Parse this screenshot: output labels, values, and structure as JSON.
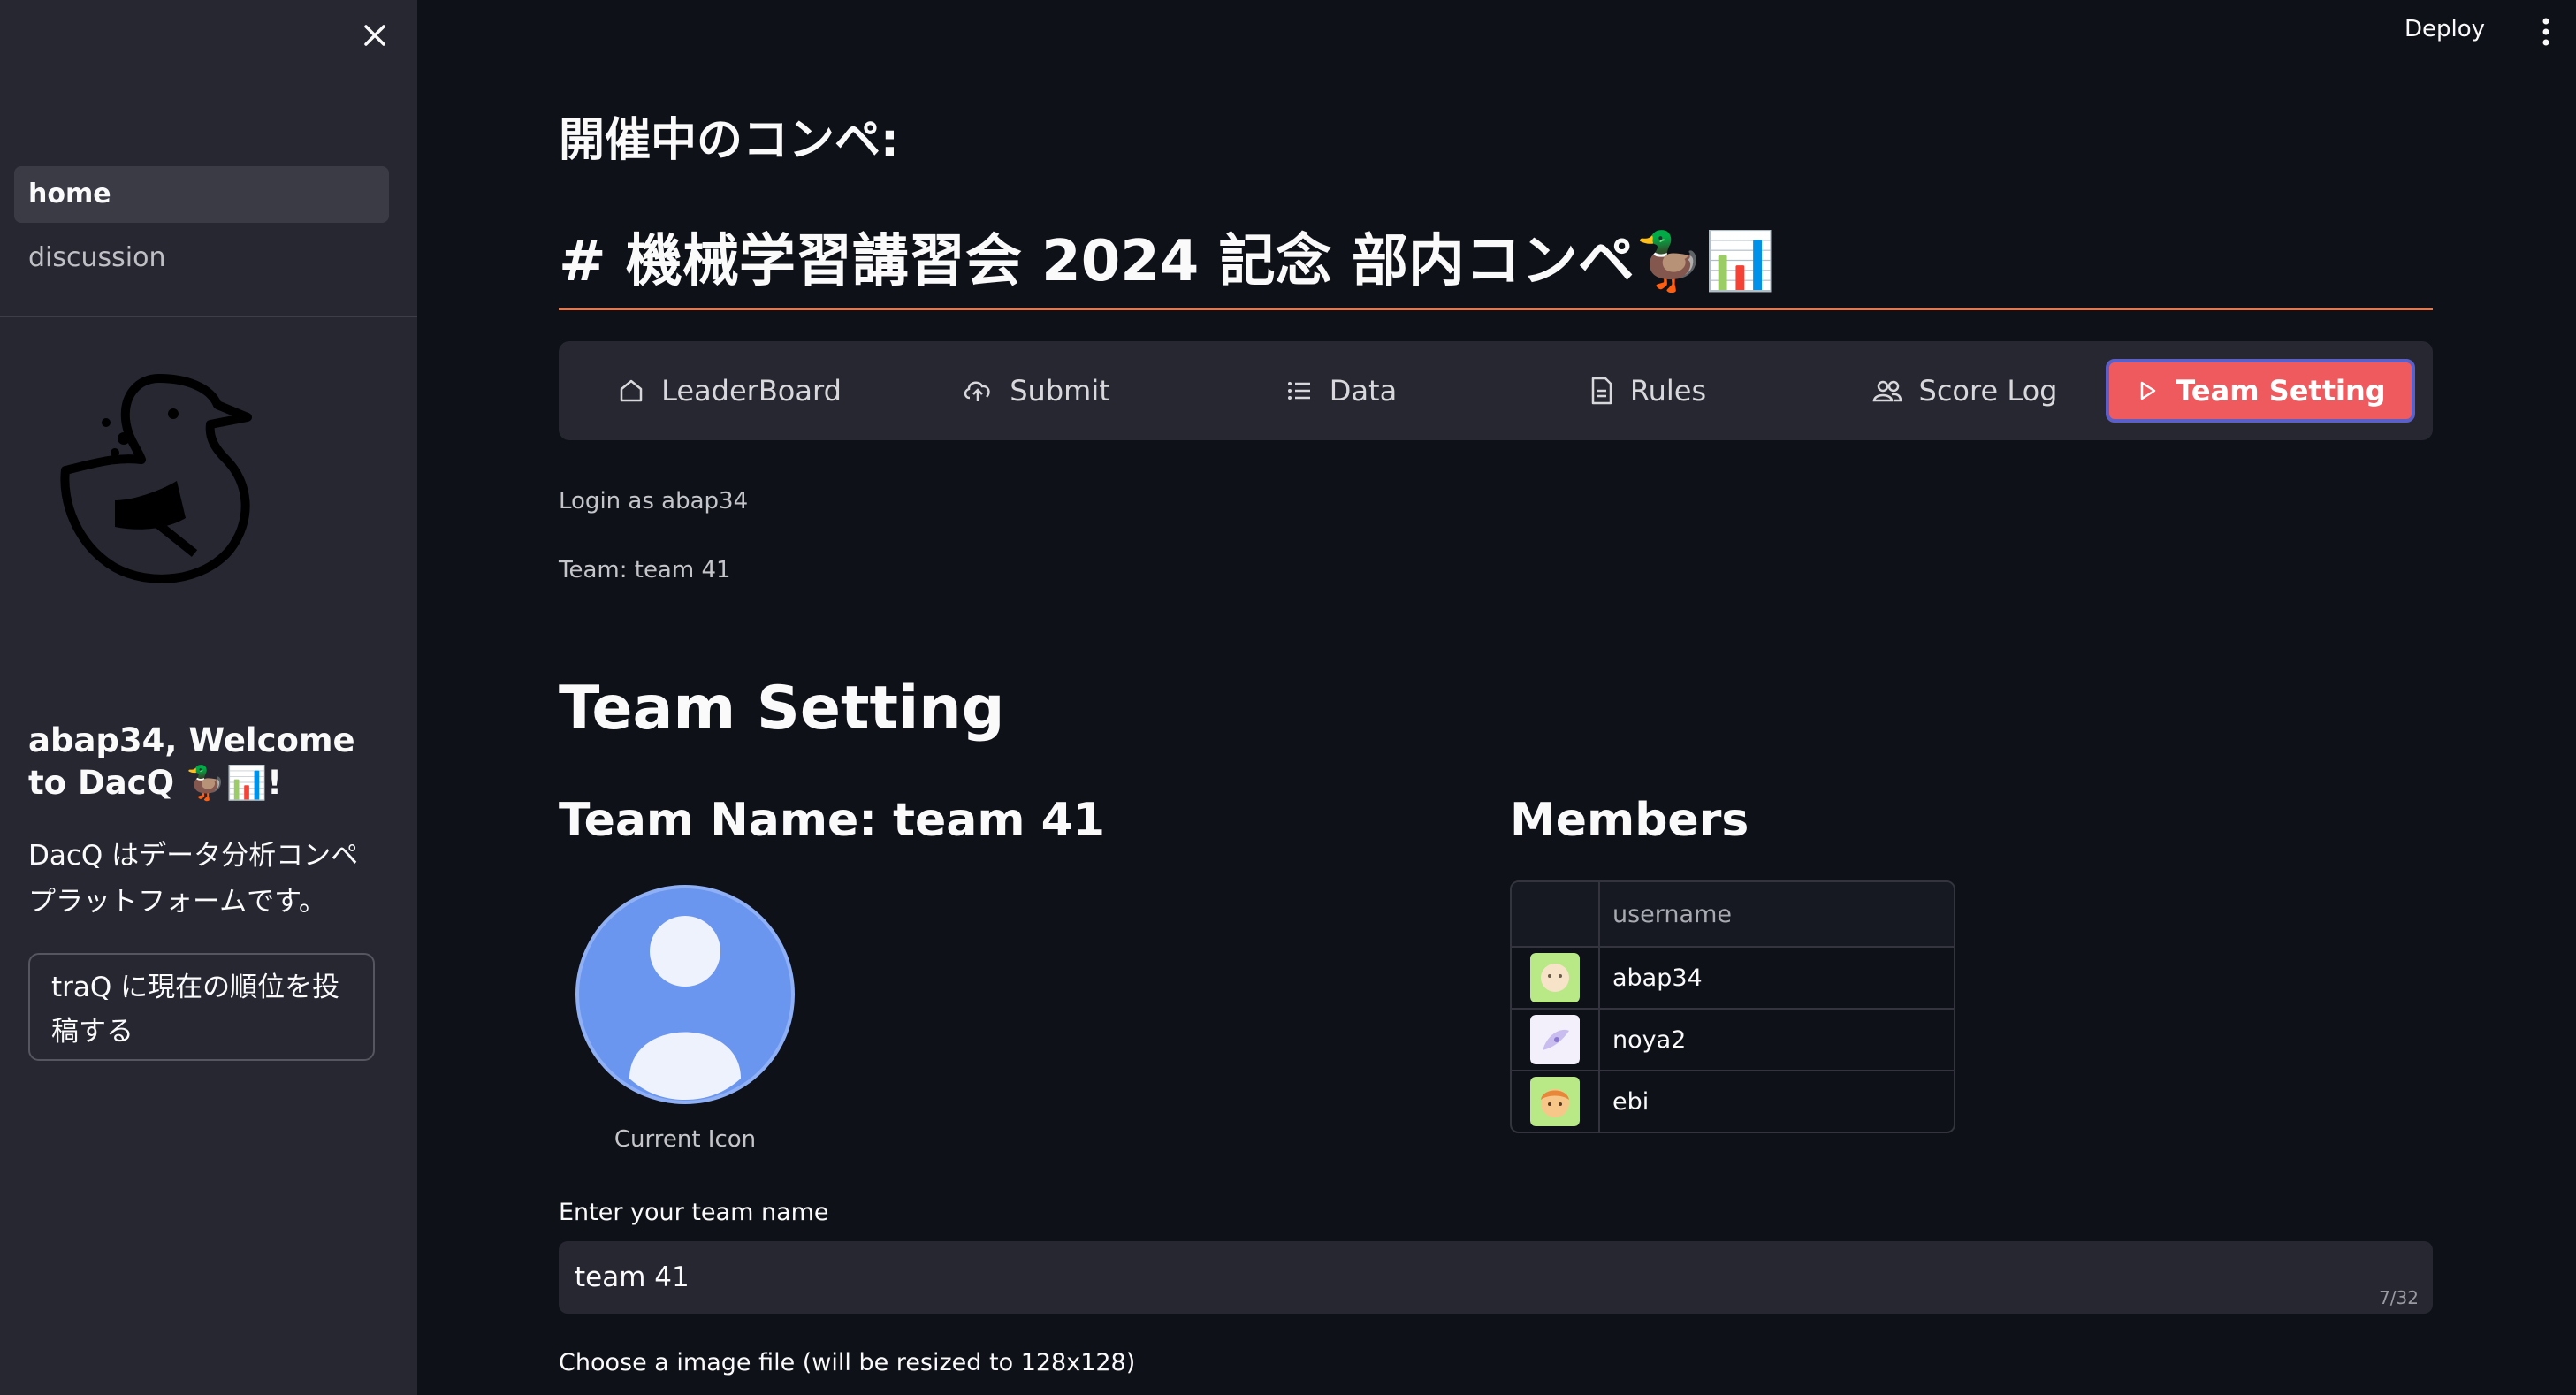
{
  "sidebar": {
    "nav": [
      {
        "label": "home",
        "active": true
      },
      {
        "label": "discussion",
        "active": false
      }
    ],
    "welcome": "abap34, Welcome to DacQ 🦆📊!",
    "description": "DacQ はデータ分析コンペプラットフォームです。",
    "post_button": "traQ に現在の順位を投稿する"
  },
  "header": {
    "deploy": "Deploy"
  },
  "main": {
    "heading": "開催中のコンペ:",
    "title": "# 機械学習講習会 2024 記念 部内コンペ🦆📊",
    "tabs": [
      {
        "label": "LeaderBoard",
        "icon": "home-icon"
      },
      {
        "label": "Submit",
        "icon": "cloud-upload-icon"
      },
      {
        "label": "Data",
        "icon": "list-icon"
      },
      {
        "label": "Rules",
        "icon": "document-icon"
      },
      {
        "label": "Score Log",
        "icon": "people-icon"
      },
      {
        "label": "Team Setting",
        "icon": "play-icon",
        "active": true
      }
    ],
    "login_text": "Login as abap34",
    "team_text": "Team: team 41",
    "section_title": "Team Setting",
    "team_name_heading": "Team Name: team 41",
    "members_heading": "Members",
    "current_icon_caption": "Current Icon",
    "members_table": {
      "header": "username",
      "rows": [
        "abap34",
        "noya2",
        "ebi"
      ]
    },
    "team_name_label": "Enter your team name",
    "team_name_value": "team 41",
    "team_name_count": "7/32",
    "file_label": "Choose a image file (will be resized to 128x128)"
  },
  "colors": {
    "background": "#0e1117",
    "sidebar": "#262730",
    "accent": "#ef5a5e",
    "title_rule": "#e8774a",
    "avatar_blue": "#6b96ef"
  }
}
